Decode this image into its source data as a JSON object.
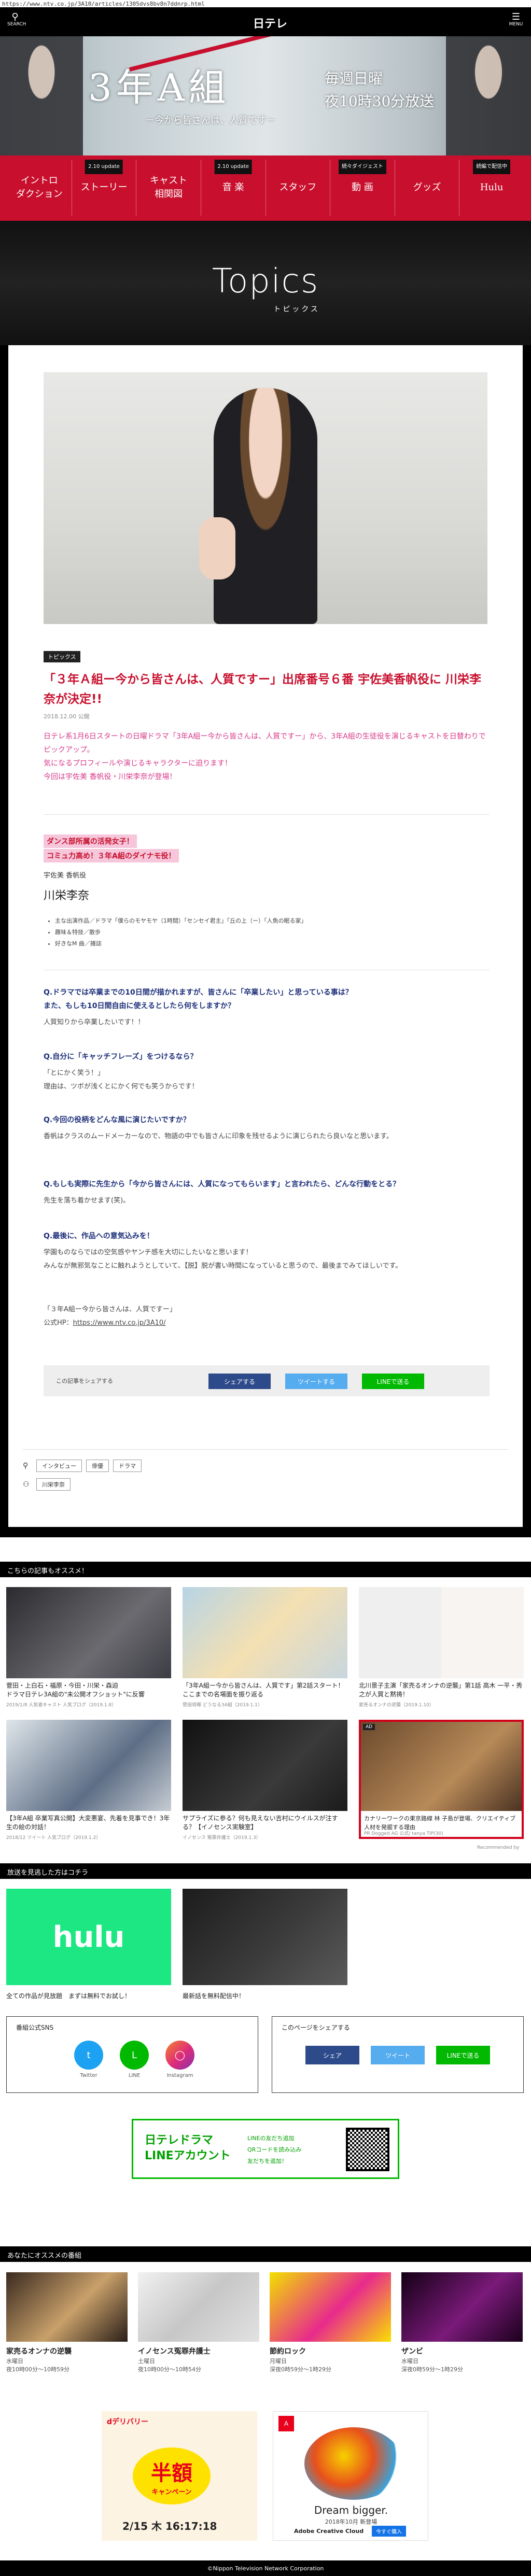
{
  "browser": {
    "url": "https://www.ntv.co.jp/3A10/articles/1305dvs8bv8n7ddnrp.html"
  },
  "global_header": {
    "search_label": "SEARCH",
    "menu_label": "MENU",
    "logo": "日テレ"
  },
  "hero": {
    "title": "3年A組",
    "subtitle": "－今から皆さんは、人質です－",
    "airtime_line1": "毎週日曜",
    "airtime_line2": "夜10時30分放送"
  },
  "nav": [
    {
      "label": "イントロ\nダクション",
      "badge": ""
    },
    {
      "label": "ストーリー",
      "badge": "2.10 update"
    },
    {
      "label": "キャスト\n相関図",
      "badge": ""
    },
    {
      "label": "音 楽",
      "badge": "2.10 update"
    },
    {
      "label": "スタッフ",
      "badge": ""
    },
    {
      "label": "動 画",
      "badge": "続々ダイジェスト"
    },
    {
      "label": "グッズ",
      "badge": ""
    },
    {
      "label": "Hulu",
      "badge": "続編で配信中"
    }
  ],
  "topics": {
    "title": "Topics",
    "subtitle": "トピックス"
  },
  "article": {
    "category": "トピックス",
    "title": "「３年Ａ組ー今から皆さんは、人質ですー」出席番号６番 宇佐美香帆役に 川栄李奈が決定!!",
    "date": "2018.12.00 公開",
    "lead": [
      "日テレ系1月6日スタートの日曜ドラマ「3年A組ー今から皆さんは、人質ですー」から、3年A組の生徒役を演じるキャストを日替わりでピックアップ。",
      "気になるプロフィールや演じるキャラクターに迫ります！",
      "今回は宇佐美 香帆役・川栄李奈が登場！"
    ],
    "highlight": [
      "ダンス部所属の活発女子！",
      "コミュ力高め！３年A組のダイナモ役！"
    ],
    "profile": {
      "role": "宇佐美 香帆役",
      "name": "川栄李奈",
      "items": [
        "主な出演作品／ドラマ「僕らのモヤモヤ（1時間）「センセイ君主」「丘の上（ー）「人魚の眠る家」",
        "趣味＆特技／散歩",
        "好きなM 曲／雑誌"
      ]
    },
    "qa": [
      {
        "q": "Q.ドラマでは卒業までの10日間が描かれますが、皆さんに「卒業したい」と思っている事は？\nまた、もしも10日間自由に使えるとしたら何をしますか？",
        "a": "人質知りから卒業したいです！！"
      },
      {
        "q": "Q.自分に「キャッチフレーズ」をつけるなら？",
        "a": "「とにかく笑う！」\n理由は、ツボが浅くとにかく何でも笑うからです！"
      },
      {
        "q": "Q.今回の役柄をどんな風に演じたいですか？",
        "a": "香帆はクラスのムードメーカーなので、物語の中でも皆さんに印象を残せるように演じられたら良いなと思います。"
      },
      {
        "q": "Q.もしも実際に先生から「今から皆さんには、人質になってもらいます」と言われたら、どんな行動をとる？",
        "a": "先生を落ち着かせます(笑)。"
      },
      {
        "q": "Q.最後に、作品への意気込みを！",
        "a": "学園ものならではの空気感やヤンチ感を大切にしたいなと思います！\nみんなが無邪気なことに触れようとしていて、【脱】脱が書い時間になっていると思うので、最後までみてほしいです。"
      }
    ],
    "footer_line1": "「３年A組ー今から皆さんは、人質ですー」",
    "footer_line2_prefix": "公式HP：",
    "footer_link": "https://www.ntv.co.jp/3A10/",
    "share": {
      "label": "この記事をシェアする",
      "facebook": "シェアする",
      "twitter": "ツイートする",
      "line": "LINEで送る"
    },
    "tags": [
      "インタビュー",
      "俳優",
      "ドラマ"
    ],
    "people_tags": [
      "川栄李奈"
    ]
  },
  "recommend": {
    "header": "こちらの記事もオススメ！",
    "items": [
      {
        "caption": "菅田・上白石・福原・今田・川栄・森迫\nドラマ日テレ3A組の\"未公開オフショット\"に反響",
        "meta": "2019/1/8 人気者キャスト 人気ブログ（2019.1.8）"
      },
      {
        "caption": "「3年A組ー今から皆さんは、人質です」第2話スタート！ここまでの名場面を振り返る",
        "meta": "菅田将暉 どうなる3A組（2019.1.1）"
      },
      {
        "caption": "北川景子主演「家売るオンナの逆襲」第1話 高木 一平・秀之が人質と黙祷！",
        "meta": "家売るオンナの逆襲（2019.1.10）"
      },
      {
        "caption": "【3年A組 卒業写真公開】大変悪宴、先着を見事でき！3年生の絵の対話！",
        "meta": "2018/12 ツイート  人気ブログ（2019.1.2）"
      },
      {
        "caption": "サプライズに参る？何も見えない吉村にウイルスが注する？【イノセンス実験室】",
        "meta": "イノセンス 冤罪弁護士（2019.1.3）"
      },
      {
        "caption": "カナリーワークの東京路線 林 子島が登場、クリエイティブ人材を発掘する理由",
        "meta": "PR  Dogged AG 公式/ tanya  TIP(30)"
      }
    ],
    "ad_badge": "AD",
    "recommended_by": "Recommended by"
  },
  "vod": {
    "header": "放送を見逃した方はコチラ",
    "hulu": "hulu",
    "hulu_caption": "全ての作品が見放題　まずは無料でお試し！",
    "clip_caption": "最新話を無料配信中！"
  },
  "follow": {
    "sns_header": "番組公式SNS",
    "twitter": "Twitter",
    "line": "LINE",
    "instagram": "Instagram",
    "share_header": "このページをシェアする",
    "share_fb": "シェア",
    "share_tw": "ツイート",
    "share_line": "LINEで送る"
  },
  "line_banner": {
    "title_line1": "日テレドラマ",
    "title_line2": "LINEアカウント",
    "bullets": [
      "LINEの友だち追加",
      "QRコードを読み込み",
      "友だちを追加！"
    ]
  },
  "programs": {
    "header": "あなたにオススメの番組",
    "items": [
      {
        "title": "家売るオンナの逆襲",
        "day": "水曜日",
        "time": "夜10時00分〜10時59分"
      },
      {
        "title": "イノセンス冤罪弁護士",
        "day": "土曜日",
        "time": "夜10時00分〜10時54分"
      },
      {
        "title": "節約ロック",
        "day": "月曜日",
        "time": "深夜0時59分〜1時29分"
      },
      {
        "title": "ザンビ",
        "day": "水曜日",
        "time": "深夜0時59分〜1時29分"
      }
    ]
  },
  "ads": {
    "delivery_title": "半額",
    "delivery_sub": "キャンペーン",
    "delivery_date": "2/15 木 16:17:18",
    "delivery_brand": "dデリバリー",
    "adobe_title": "Dream bigger.",
    "adobe_release": "2018年10月 新登場",
    "adobe_brand": "Adobe Creative Cloud",
    "adobe_cta": "今すぐ購入"
  },
  "footer": {
    "copyright": "©Nippon Television Network Corporation"
  }
}
